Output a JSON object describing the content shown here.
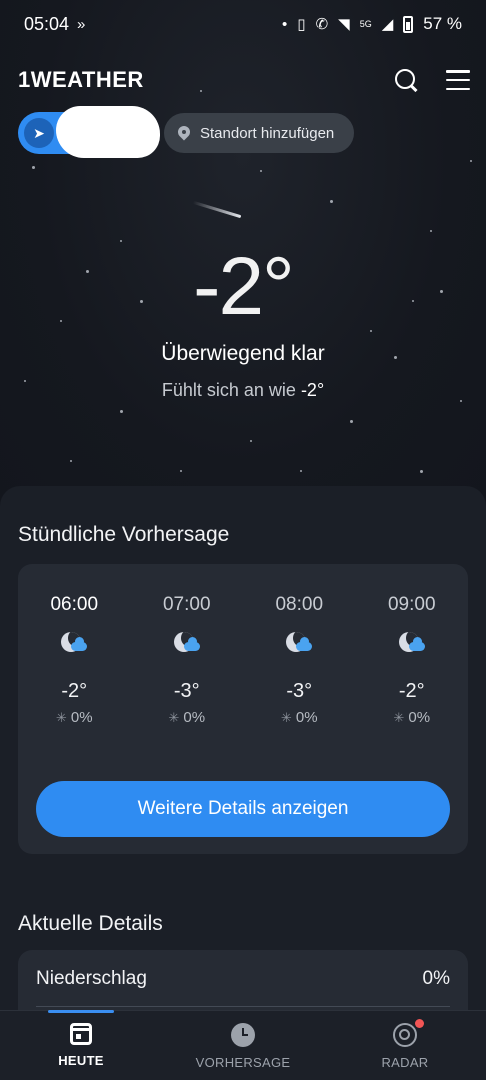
{
  "status_bar": {
    "time": "05:04",
    "network": "5G",
    "battery": "57 %"
  },
  "header": {
    "logo": "1WEATHER"
  },
  "location": {
    "add_label": "Standort hinzufügen"
  },
  "current": {
    "temperature": "-2°",
    "condition": "Überwiegend klar",
    "feels_like_label": "Fühlt sich an wie",
    "feels_like_value": "-2°"
  },
  "hourly": {
    "title": "Stündliche Vorhersage",
    "items": [
      {
        "time": "06:00",
        "temp": "-2°",
        "precip": "0%",
        "icon": "moon-cloud-icon"
      },
      {
        "time": "07:00",
        "temp": "-3°",
        "precip": "0%",
        "icon": "moon-cloud-icon"
      },
      {
        "time": "08:00",
        "temp": "-3°",
        "precip": "0%",
        "icon": "moon-cloud-icon"
      },
      {
        "time": "09:00",
        "temp": "-2°",
        "precip": "0%",
        "icon": "moon-cloud-icon"
      }
    ],
    "details_button": "Weitere Details anzeigen"
  },
  "current_details": {
    "title": "Aktuelle Details",
    "rows": [
      {
        "label": "Niederschlag",
        "value": "0%"
      }
    ]
  },
  "bottom_nav": {
    "items": [
      {
        "label": "HEUTE",
        "icon": "calendar-icon",
        "active": true
      },
      {
        "label": "VORHERSAGE",
        "icon": "clock-icon",
        "active": false
      },
      {
        "label": "RADAR",
        "icon": "radar-icon",
        "active": false
      }
    ]
  },
  "colors": {
    "accent": "#2f8cf2",
    "background": "#13161d",
    "card": "#262b34",
    "notification_dot": "#f25555"
  }
}
